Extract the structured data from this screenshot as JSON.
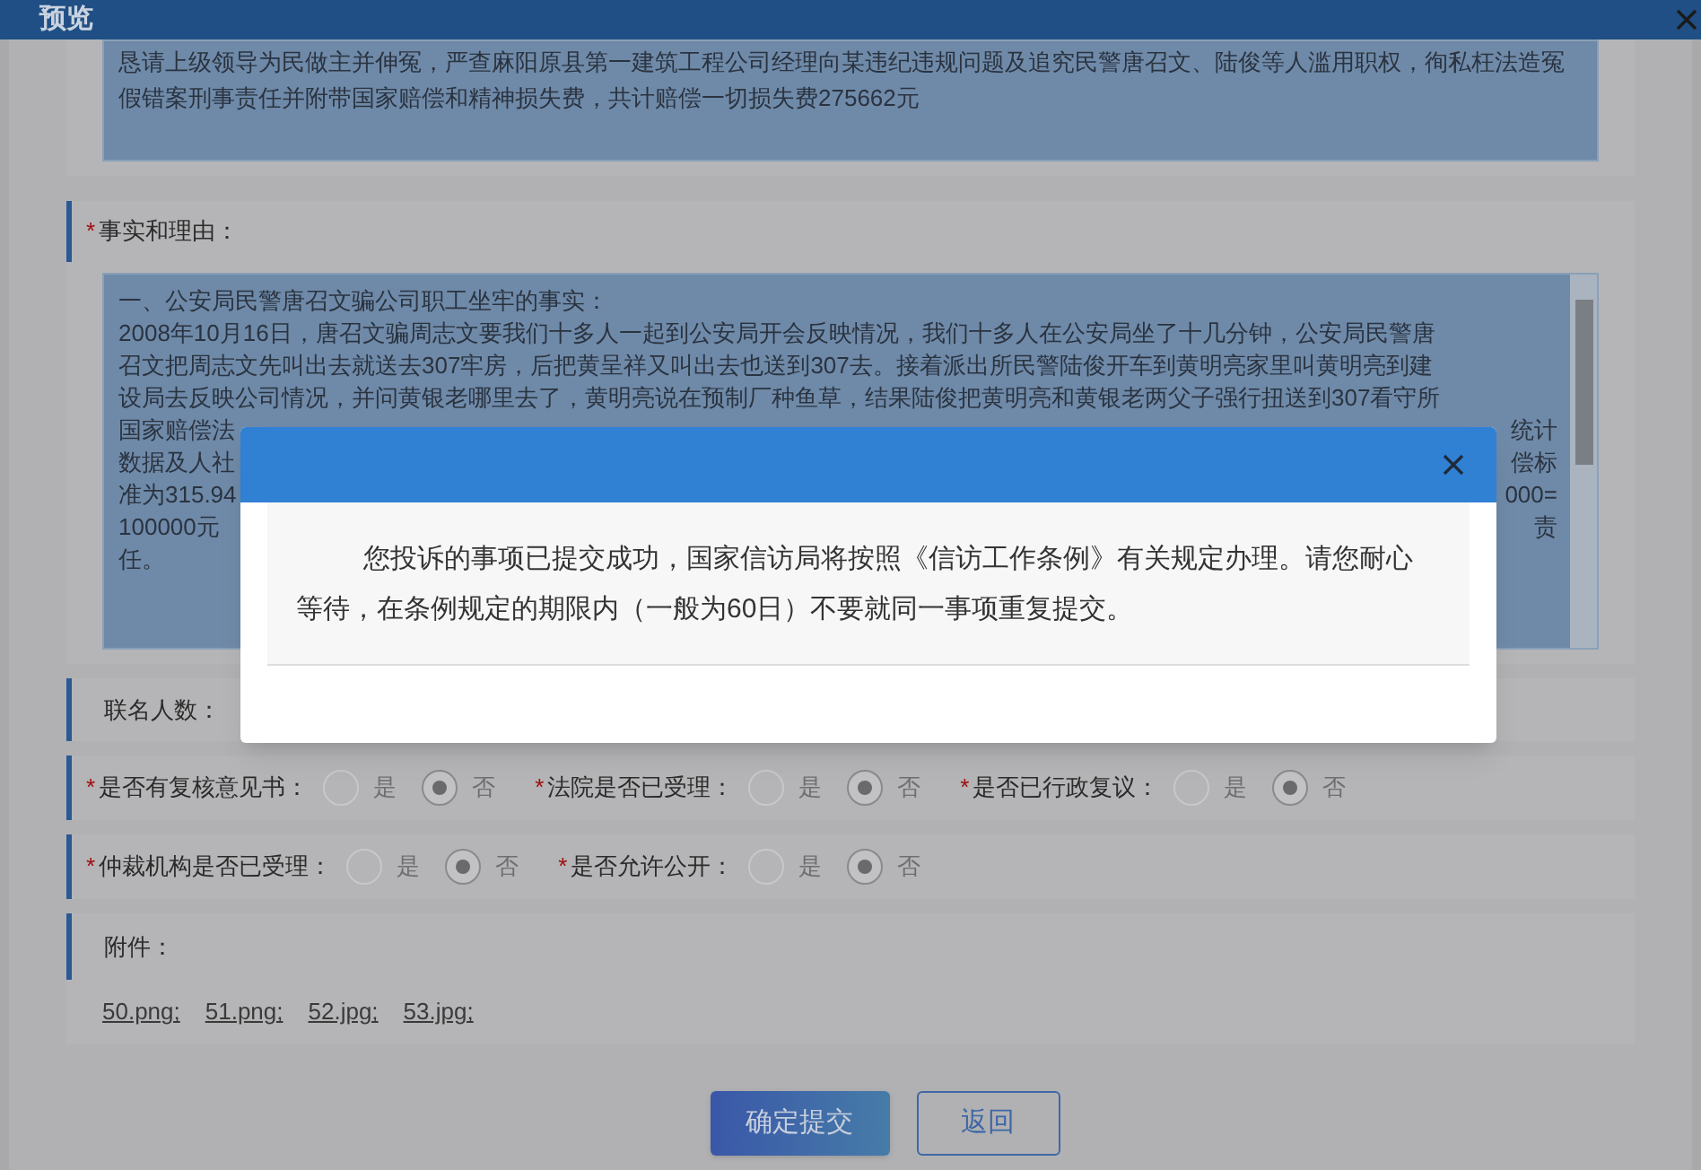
{
  "window": {
    "title": "预览"
  },
  "request_text": "恳请上级领导为民做主并伸冤，严查麻阳原县第一建筑工程公司经理向某违纪违规问题及追究民警唐召文、陆俊等人滥用职权，徇私枉法造冤假错案刑事责任并附带国家赔偿和精神损失费，共计赔偿一切损失费275662元",
  "facts": {
    "mark": "*",
    "label": "事实和理由：",
    "lines": [
      {
        "left": "一、公安局民警唐召文骗公司职工坐牢的事实："
      },
      {
        "left": "2008年10月16日，唐召文骗周志文要我们十多人一起到公安局开会反映情况，我们十多人在公安局坐了十几分钟，公安局民警唐"
      },
      {
        "left": "召文把周志文先叫出去就送去307牢房，后把黄呈祥又叫出去也送到307去。接着派出所民警陆俊开车到黄明亮家里叫黄明亮到建"
      },
      {
        "left": "设局去反映公司情况，并问黄银老哪里去了，黄明亮说在预制厂种鱼草，结果陆俊把黄明亮和黄银老两父子强行扭送到307看守所"
      },
      {
        "left": "国家赔偿法",
        "right": "统计"
      },
      {
        "left": "数据及人社",
        "right": "偿标"
      },
      {
        "left": "准为315.94",
        "right": "000="
      },
      {
        "left": "100000元",
        "right": "责"
      },
      {
        "left": "任。"
      }
    ]
  },
  "cosigners": {
    "label": "联名人数："
  },
  "questions": [
    [
      {
        "mark": "*",
        "label": "是否有复核意见书：",
        "options": [
          {
            "label": "是",
            "selected": false
          },
          {
            "label": "否",
            "selected": true
          }
        ]
      },
      {
        "mark": "*",
        "label": "法院是否已受理：",
        "options": [
          {
            "label": "是",
            "selected": false
          },
          {
            "label": "否",
            "selected": true
          }
        ]
      },
      {
        "mark": "*",
        "label": "是否已行政复议：",
        "options": [
          {
            "label": "是",
            "selected": false
          },
          {
            "label": "否",
            "selected": true
          }
        ]
      }
    ],
    [
      {
        "mark": "*",
        "label": "仲裁机构是否已受理：",
        "options": [
          {
            "label": "是",
            "selected": false
          },
          {
            "label": "否",
            "selected": true
          }
        ]
      },
      {
        "mark": "*",
        "label": "是否允许公开：",
        "options": [
          {
            "label": "是",
            "selected": false
          },
          {
            "label": "否",
            "selected": true
          }
        ]
      }
    ]
  ],
  "attachments": {
    "label": "附件：",
    "files": [
      "50.png;",
      "51.png;",
      "52.jpg;",
      "53.jpg;"
    ]
  },
  "buttons": [
    {
      "label": "确定提交",
      "kind": "primary"
    },
    {
      "label": "返回",
      "kind": "secondary"
    }
  ],
  "dialog": {
    "message": "您投诉的事项已提交成功，国家信访局将按照《信访工作条例》有关规定办理。请您耐心等待，在条例规定的期限内（一般为60日）不要就同一事项重复提交。"
  }
}
